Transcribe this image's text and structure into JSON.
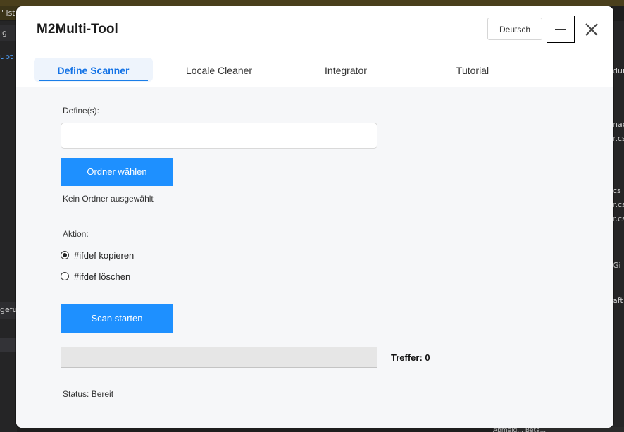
{
  "background": {
    "top_text": "' ist a",
    "left_texts": [
      "ig",
      "ubt",
      "gefu"
    ],
    "right_texts": [
      "dur",
      "nag",
      "r.cs",
      "cs",
      "r.cs",
      "r.cs",
      "Gi",
      "aft"
    ],
    "bottom_text": "Abmeld... Beta..."
  },
  "window": {
    "title": "M2Multi-Tool",
    "language_button": "Deutsch",
    "minimize_icon": "minimize-icon",
    "close_icon": "close-icon"
  },
  "tabs": [
    {
      "label": "Define Scanner",
      "active": true
    },
    {
      "label": "Locale Cleaner",
      "active": false
    },
    {
      "label": "Integrator",
      "active": false
    },
    {
      "label": "Tutorial",
      "active": false
    }
  ],
  "scanner": {
    "defines_label": "Define(s):",
    "defines_value": "",
    "choose_folder_button": "Ordner wählen",
    "folder_status": "Kein Ordner ausgewählt",
    "action_label": "Aktion:",
    "actions": [
      {
        "label": "#ifdef kopieren",
        "selected": true
      },
      {
        "label": "#ifdef löschen",
        "selected": false
      }
    ],
    "scan_button": "Scan starten",
    "progress_fraction": 0,
    "hits_label": "Treffer: 0",
    "status": "Status: Bereit"
  },
  "colors": {
    "accent": "#1e90ff",
    "active_tab_text": "#1473e6",
    "content_background": "#f6f7f9"
  }
}
